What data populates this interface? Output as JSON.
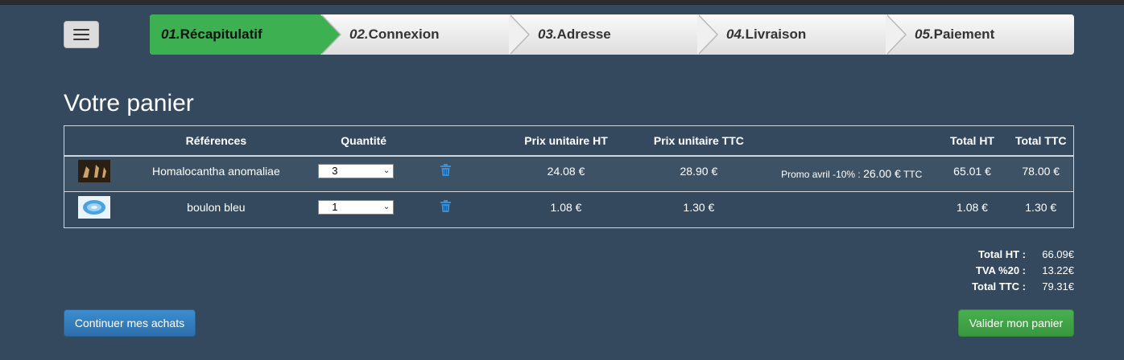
{
  "steps": [
    {
      "num": "01.",
      "label": "Récapitulatif"
    },
    {
      "num": "02.",
      "label": "Connexion"
    },
    {
      "num": "03.",
      "label": "Adresse"
    },
    {
      "num": "04.",
      "label": "Livraison"
    },
    {
      "num": "05.",
      "label": "Paiement"
    }
  ],
  "page_title": "Votre panier",
  "table": {
    "headers": [
      "Références",
      "Quantité",
      "Prix unitaire HT",
      "Prix unitaire TTC",
      "Total HT",
      "Total TTC"
    ],
    "rows": [
      {
        "reference": "Homalocantha anomaliae",
        "quantity": "3",
        "unit_ht": "24.08 €",
        "unit_ttc": "28.90 €",
        "promo_label": "Promo avril -10% :",
        "promo_price": "26.00 €",
        "promo_suffix": "TTC",
        "total_ht": "65.01 €",
        "total_ttc": "78.00 €"
      },
      {
        "reference": "boulon bleu",
        "quantity": "1",
        "unit_ht": "1.08 €",
        "unit_ttc": "1.30 €",
        "total_ht": "1.08 €",
        "total_ttc": "1.30 €"
      }
    ]
  },
  "totals": {
    "ht_label": "Total HT :",
    "ht_value": "66.09€",
    "tva_label": "TVA %20 :",
    "tva_value": "13.22€",
    "ttc_label": "Total TTC :",
    "ttc_value": "79.31€"
  },
  "buttons": {
    "continue": "Continuer mes achats",
    "validate": "Valider mon panier"
  },
  "colors": {
    "background": "#34495e",
    "active_step": "#3db152",
    "primary_button": "#337ab7",
    "success_button": "#44a549"
  }
}
